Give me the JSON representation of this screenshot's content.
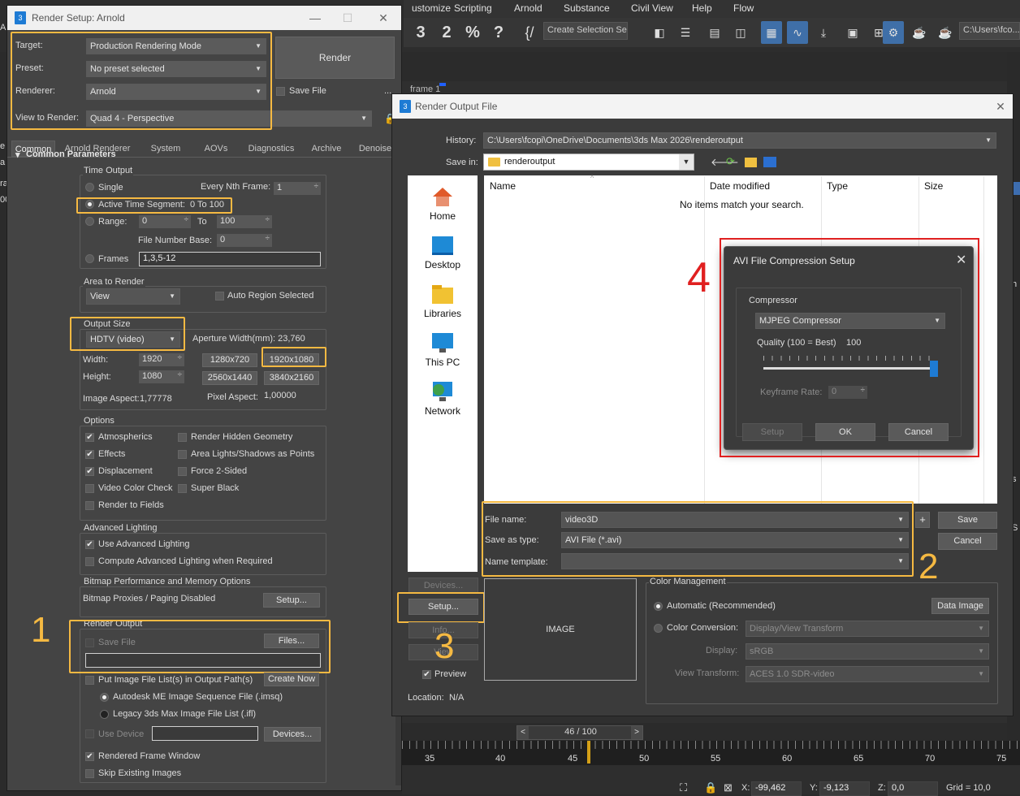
{
  "main_app": {
    "menus": [
      "ustomize",
      "Scripting",
      "Arnold",
      "Substance",
      "Civil View",
      "Help",
      "Flow"
    ],
    "toolbar_snaps": [
      "3",
      "2",
      "%",
      "?"
    ],
    "selection_set_placeholder": "Create Selection Se",
    "path": "C:\\Users\\fco...",
    "left_edge_texts": [
      "Al",
      "e",
      "a",
      "ra",
      "00"
    ],
    "time_slider": "46 / 100",
    "ruler_ticks": [
      "35",
      "40",
      "45",
      "50",
      "55",
      "60",
      "65",
      "70",
      "75"
    ],
    "status": {
      "x_label": "X:",
      "x_value": "-99,462",
      "y_label": "Y:",
      "y_value": "-9,123",
      "z_label": "Z:",
      "z_value": "0,0",
      "grid": "Grid = 10,0"
    },
    "viewport_label": "frame 1",
    "right_edge_texts": [
      "h",
      "s",
      "S"
    ]
  },
  "render_setup": {
    "app_icon": "3",
    "title": "Render Setup: Arnold",
    "target_label": "Target:",
    "target_value": "Production Rendering Mode",
    "preset_label": "Preset:",
    "preset_value": "No preset selected",
    "renderer_label": "Renderer:",
    "renderer_value": "Arnold",
    "view_label": "View to Render:",
    "view_value": "Quad 4 - Perspective",
    "render_button": "Render",
    "save_file_label": "Save File",
    "ellipsis": "...",
    "tabs": [
      "Common",
      "Arnold Renderer",
      "System",
      "AOVs",
      "Diagnostics",
      "Archive",
      "Denoise"
    ],
    "rollout_title": "Common Parameters",
    "time_output": {
      "title": "Time Output",
      "single": "Single",
      "every_nth_label": "Every Nth Frame:",
      "every_nth_value": "1",
      "active_segment": "Active Time Segment:",
      "active_range": "0 To 100",
      "range_label": "Range:",
      "range_from": "0",
      "range_to_label": "To",
      "range_to": "100",
      "file_number_base_label": "File Number Base:",
      "file_number_base": "0",
      "frames_label": "Frames",
      "frames_value": "1,3,5-12"
    },
    "area_to_render": {
      "title": "Area to Render",
      "value": "View",
      "auto_region": "Auto Region Selected"
    },
    "output_size": {
      "title": "Output Size",
      "preset": "HDTV (video)",
      "aperture": "Aperture Width(mm): 23,760",
      "width_label": "Width:",
      "width_value": "1920",
      "height_label": "Height:",
      "height_value": "1080",
      "presets": [
        "1280x720",
        "1920x1080",
        "2560x1440",
        "3840x2160"
      ],
      "image_aspect_label": "Image Aspect:",
      "image_aspect_value": "1,77778",
      "pixel_aspect_label": "Pixel Aspect:",
      "pixel_aspect_value": "1,00000"
    },
    "options": {
      "title": "Options",
      "left": [
        {
          "label": "Atmospherics",
          "checked": "✔"
        },
        {
          "label": "Effects",
          "checked": "✔"
        },
        {
          "label": "Displacement",
          "checked": "✔"
        },
        {
          "label": "Video Color Check",
          "checked": ""
        },
        {
          "label": "Render to Fields",
          "checked": ""
        }
      ],
      "right": [
        {
          "label": "Render Hidden Geometry",
          "checked": ""
        },
        {
          "label": "Area Lights/Shadows as Points",
          "checked": ""
        },
        {
          "label": "Force 2-Sided",
          "checked": ""
        },
        {
          "label": "Super Black",
          "checked": ""
        }
      ]
    },
    "advanced_lighting": {
      "title": "Advanced Lighting",
      "use": "Use Advanced Lighting",
      "compute": "Compute Advanced Lighting when Required"
    },
    "bitmap": {
      "title": "Bitmap Performance and Memory Options",
      "status": "Bitmap Proxies / Paging Disabled",
      "setup": "Setup..."
    },
    "render_output": {
      "title": "Render Output",
      "save_file": "Save File",
      "files": "Files...",
      "put_image_list": "Put Image File List(s) in Output Path(s)",
      "create_now": "Create Now",
      "imsq": "Autodesk ME Image Sequence File (.imsq)",
      "ifl": "Legacy 3ds Max Image File List (.ifl)",
      "use_device": "Use Device",
      "devices": "Devices...",
      "rendered_frame_window": "Rendered Frame Window",
      "skip_existing": "Skip Existing Images"
    }
  },
  "render_output_file": {
    "title": "Render Output File",
    "history_label": "History:",
    "history_value": "C:\\Users\\fcopi\\OneDrive\\Documents\\3ds Max 2026\\renderoutput",
    "save_in_label": "Save in:",
    "save_in_value": "renderoutput",
    "nav": [
      "Home",
      "Desktop",
      "Libraries",
      "This PC",
      "Network"
    ],
    "columns": [
      "Name",
      "Date modified",
      "Type",
      "Size"
    ],
    "empty_message": "No items match your search.",
    "file_name_label": "File name:",
    "file_name_value": "video3D",
    "save_as_type_label": "Save as type:",
    "save_as_type_value": "AVI File (*.avi)",
    "name_template_label": "Name template:",
    "name_template_value": "",
    "plus": "+",
    "save": "Save",
    "cancel": "Cancel",
    "devices": "Devices...",
    "setup": "Setup...",
    "info": "Info...",
    "view": "View",
    "preview_label": "Preview",
    "image_placeholder": "IMAGE",
    "location_label": "Location:",
    "location_value": "N/A",
    "color_management": {
      "title": "Color Management",
      "automatic": "Automatic (Recommended)",
      "data_image": "Data Image",
      "conversion": "Color Conversion:",
      "conversion_value": "Display/View Transform",
      "display_label": "Display:",
      "display_value": "sRGB",
      "view_transform_label": "View Transform:",
      "view_transform_value": "ACES 1.0 SDR-video"
    }
  },
  "avi_dialog": {
    "title": "AVI File Compression Setup",
    "compressor_label": "Compressor",
    "compressor_value": "MJPEG Compressor",
    "quality_label": "Quality (100 = Best)",
    "quality_value": "100",
    "quality_fraction": 1.0,
    "keyframe_label": "Keyframe Rate:",
    "keyframe_value": "0",
    "setup": "Setup",
    "ok": "OK",
    "cancel": "Cancel"
  },
  "annotations": [
    "1",
    "2",
    "3",
    "4"
  ],
  "colors": {
    "highlight": "#f5b942",
    "red_box": "#e02020",
    "accent_blue": "#1e7bd4"
  }
}
